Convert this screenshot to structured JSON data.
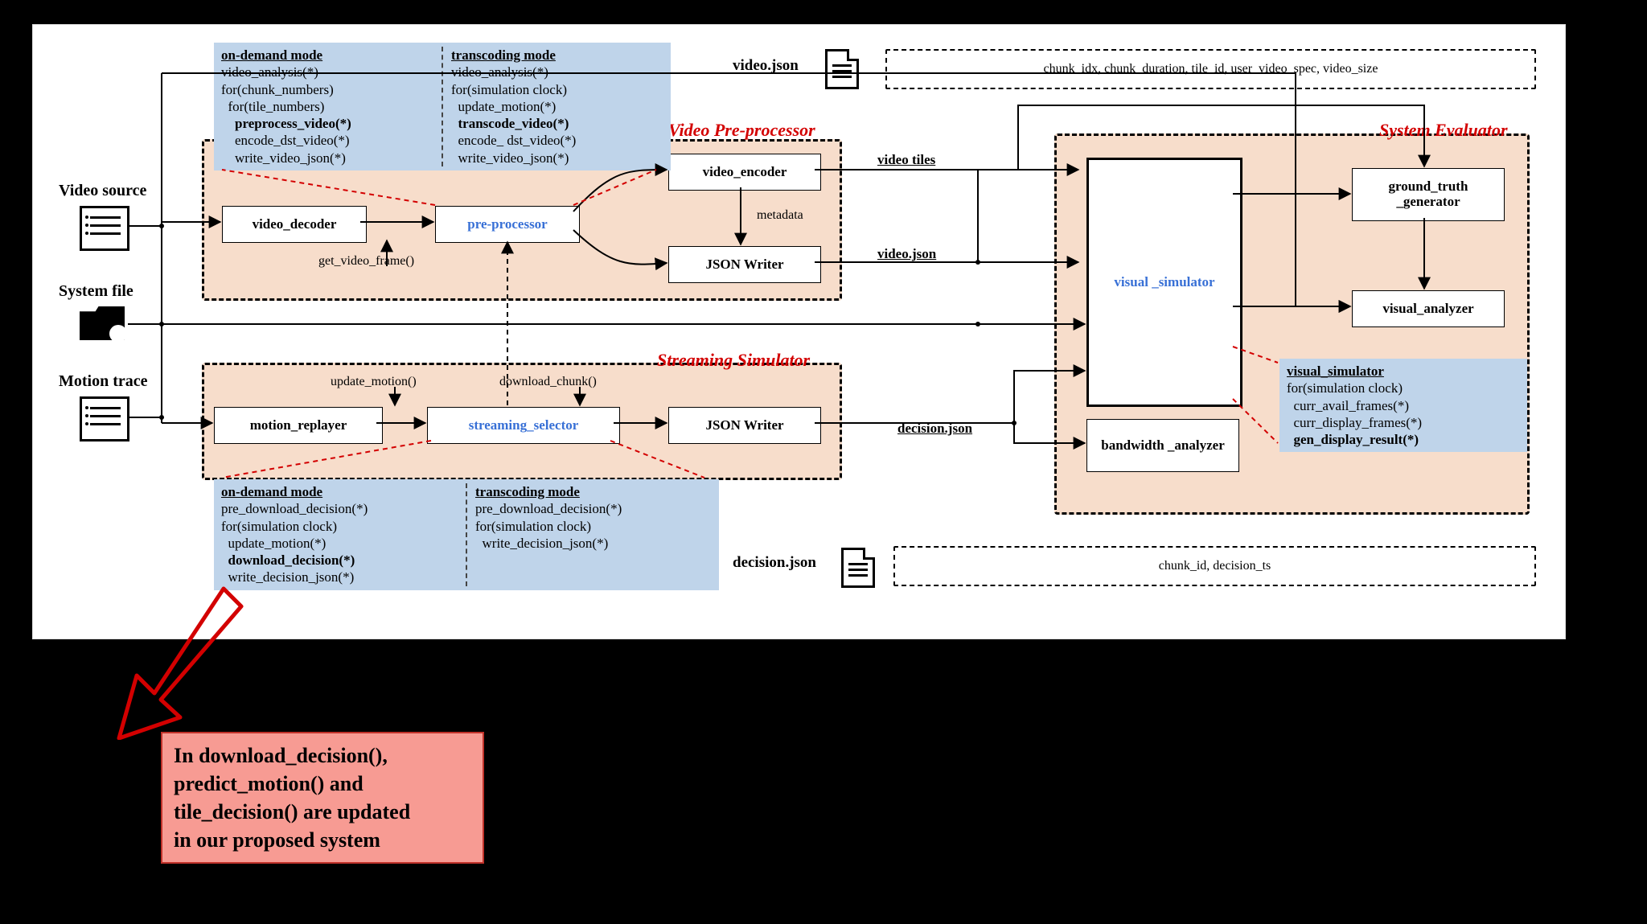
{
  "inputs": {
    "video_source": "Video source",
    "system_file": "System file",
    "motion_trace": "Motion trace"
  },
  "files": {
    "video_json": "video.json",
    "decision_json": "decision.json",
    "video_json_fields": "chunk_idx, chunk_duration, tile_id, user_video_spec, video_size",
    "decision_json_fields": "chunk_id, decision_ts"
  },
  "regions": {
    "preproc_title": "Video Pre-processor",
    "stream_title": "Streaming Simulator",
    "eval_title": "System Evaluator"
  },
  "nodes": {
    "video_decoder": "video_decoder",
    "pre_processor": "pre-processor",
    "video_encoder": "video_encoder",
    "json_writer": "JSON Writer",
    "motion_replayer": "motion_replayer",
    "streaming_selector": "streaming_selector",
    "json_writer2": "JSON Writer",
    "visual_simulator": "visual _simulator",
    "ground_truth": "ground_truth _generator",
    "visual_analyzer": "visual_analyzer",
    "bandwidth_analyzer": "bandwidth _analyzer"
  },
  "arrows": {
    "get_video_frame": "get_video_frame()",
    "metadata": "metadata",
    "video_tiles": "video tiles",
    "video_json_arrow": "video.json",
    "decision_json_arrow": "decision.json",
    "update_motion": "update_motion()",
    "download_chunk": "download_chunk()"
  },
  "preproc_code": {
    "left_header": "on-demand mode",
    "left_l1": "video_analysis(*)",
    "left_l2": "for(chunk_numbers)",
    "left_l3": "  for(tile_numbers)",
    "left_l4b": "    preprocess_video(*)",
    "left_l5": "    encode_dst_video(*)",
    "left_l6": "    write_video_json(*)",
    "right_header": "transcoding mode",
    "right_l1": "video_analysis(*)",
    "right_l2": "for(simulation clock)",
    "right_l3": "  update_motion(*)",
    "right_l4b": "  transcode_video(*)",
    "right_l5": "  encode_ dst_video(*)",
    "right_l6": "  write_video_json(*)"
  },
  "stream_code": {
    "left_header": "on-demand mode",
    "left_l1": "pre_download_decision(*)",
    "left_l2": "for(simulation clock)",
    "left_l3": "  update_motion(*)",
    "left_l4b": "  download_decision(*)",
    "left_l5": "  write_decision_json(*)",
    "right_header": "transcoding mode",
    "right_l1": "pre_download_decision(*)",
    "right_l2": "for(simulation clock)",
    "right_l3": "  write_decision_json(*)"
  },
  "eval_code": {
    "header": "visual_simulator",
    "l1": "for(simulation clock)",
    "l2": "  curr_avail_frames(*)",
    "l3": "  curr_display_frames(*)",
    "l4b": "  gen_display_result(*)"
  },
  "callout": {
    "text1": "In download_decision(),",
    "text2": "predict_motion() and",
    "text3": "tile_decision() are updated",
    "text4": "in our proposed system"
  }
}
